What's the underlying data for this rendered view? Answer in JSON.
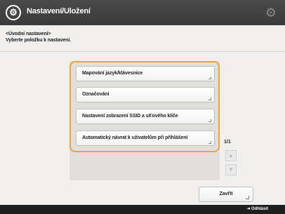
{
  "header": {
    "title": "Nastavení/Uložení",
    "app_icon": "settings-circle-icon",
    "corner_icon": "gear-icon"
  },
  "breadcrumb": {
    "line1": "<Úvodní nastavení>",
    "line2": "Vyberte položku k nastavení."
  },
  "items": [
    {
      "label": "Mapování jazyk/klávesnice"
    },
    {
      "label": "Označování"
    },
    {
      "label": "Nastavení zobrazení SSID a síťového klíče"
    },
    {
      "label": "Automatický návrat k uživatelům při přihlášení"
    }
  ],
  "pager": {
    "text": "1/1",
    "up_icon": "triangle-up-icon",
    "down_icon": "triangle-down-icon"
  },
  "close_button": {
    "label": "Zavřít"
  },
  "status": {
    "logout_label": "Odhlásit"
  },
  "colors": {
    "accent": "#f0a23a",
    "background": "#f1f0ee",
    "titlebar": "#3f3f3f"
  }
}
